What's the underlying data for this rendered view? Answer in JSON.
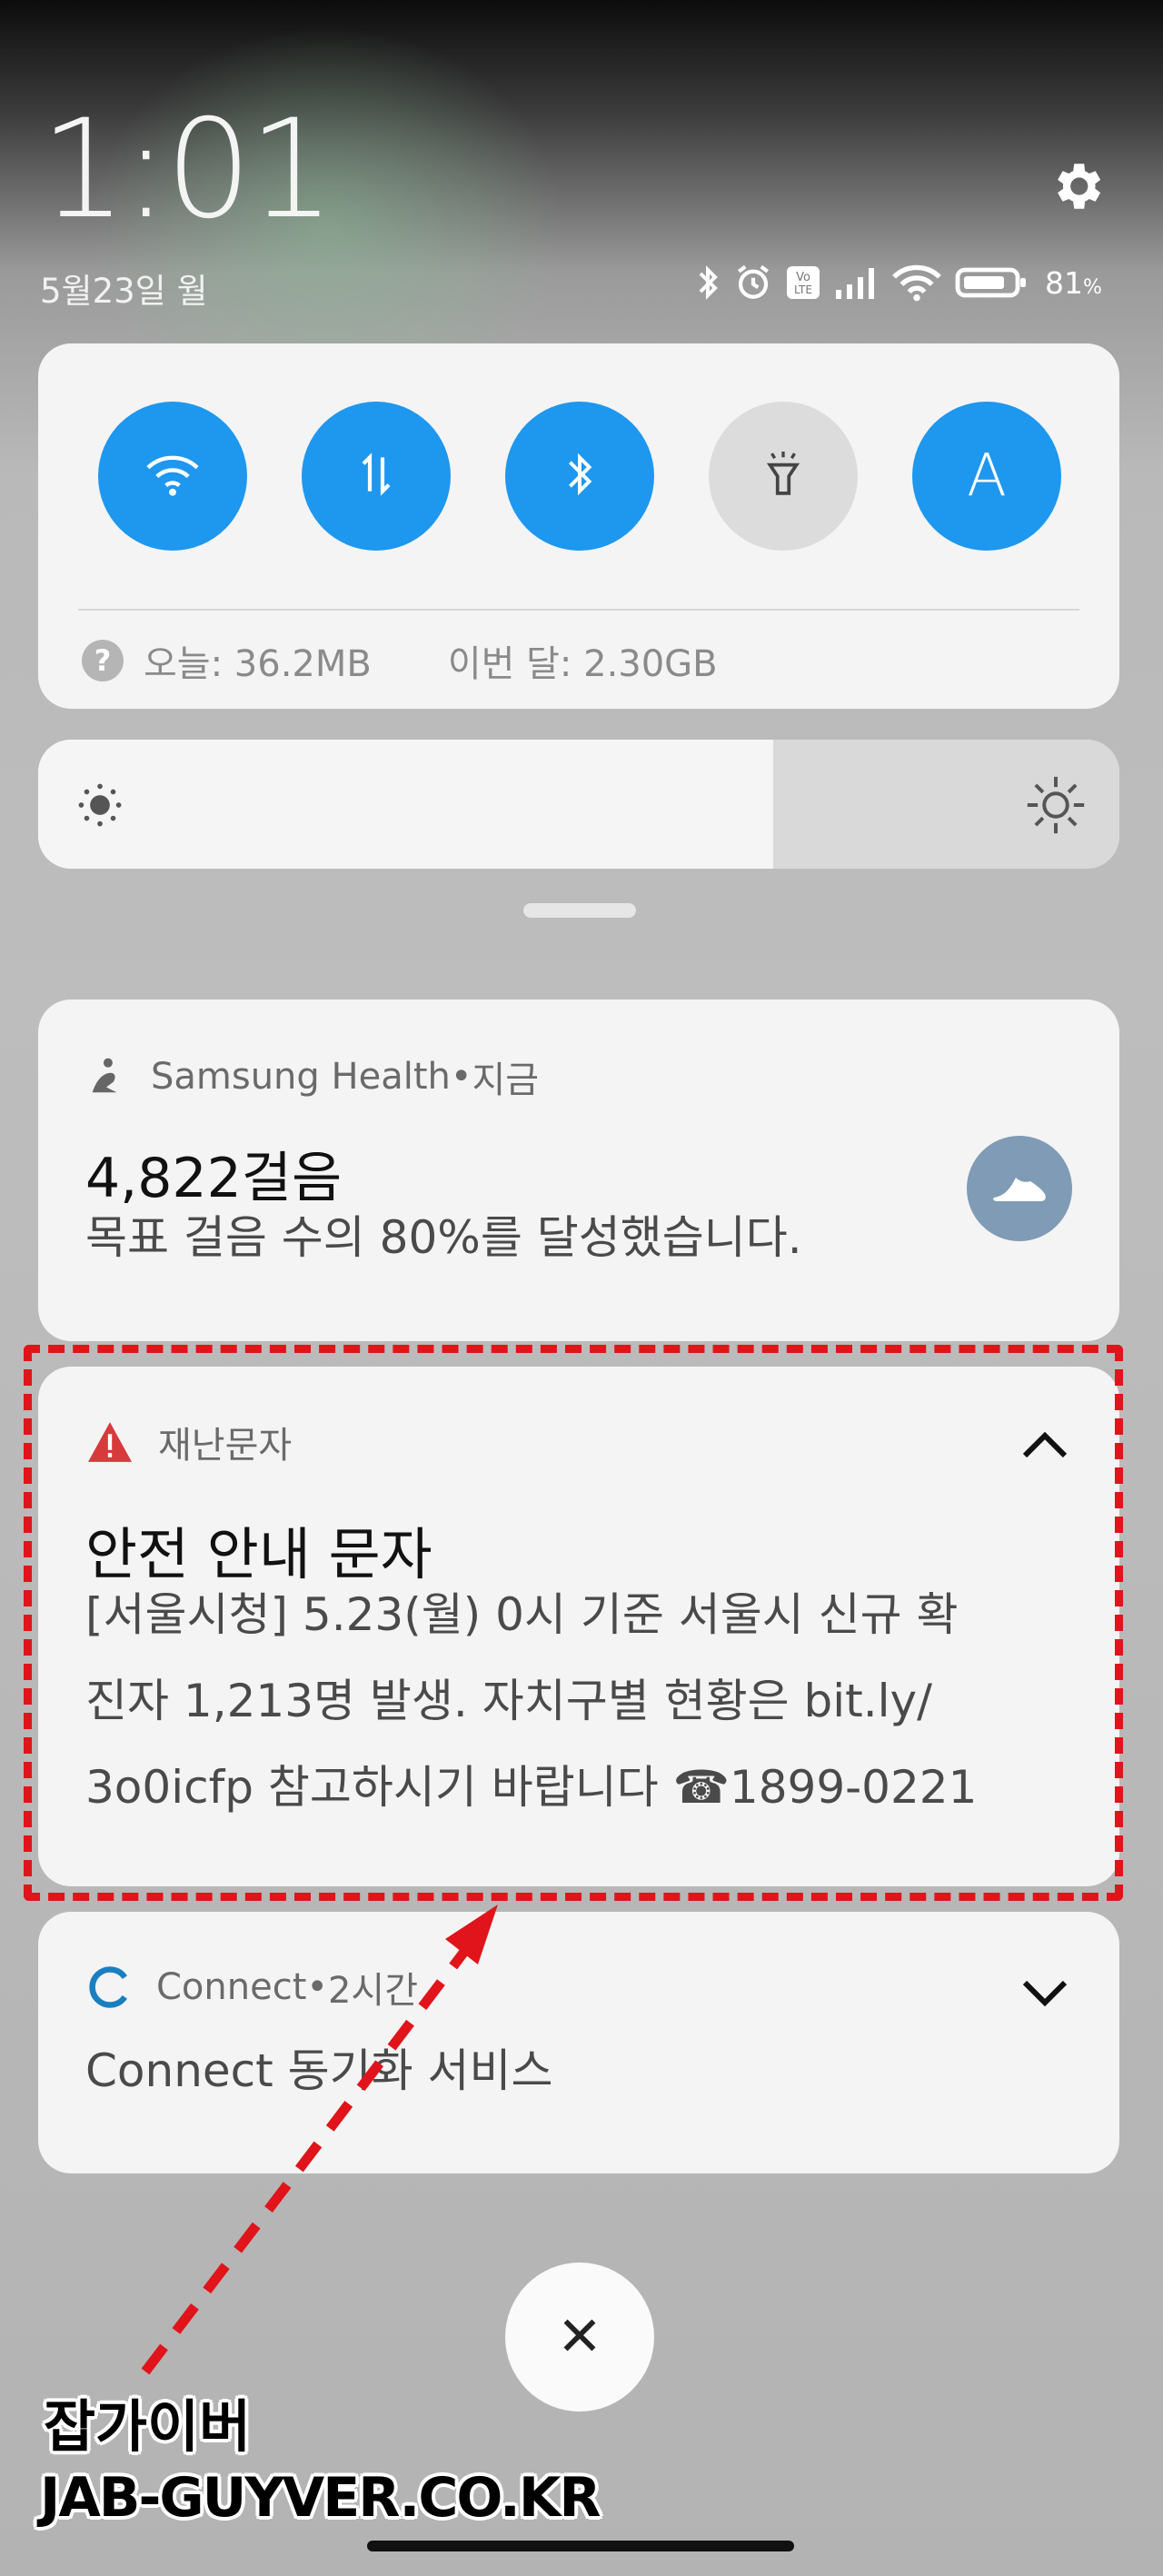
{
  "status": {
    "time": "1:01",
    "date": "5월23일 월",
    "battery_pct": "81",
    "battery_unit": "%"
  },
  "quick_settings": {
    "toggles": [
      {
        "name": "wifi",
        "icon": "wifi-icon",
        "on": true
      },
      {
        "name": "mobile-data",
        "icon": "data-arrows-icon",
        "on": true
      },
      {
        "name": "bluetooth",
        "icon": "bluetooth-icon",
        "on": true
      },
      {
        "name": "flashlight",
        "icon": "flashlight-icon",
        "on": false
      },
      {
        "name": "auto-brightness",
        "icon": "letter-a-icon",
        "label": "A",
        "on": true
      }
    ],
    "data_today": "오늘: 36.2MB",
    "data_month": "이번 달: 2.30GB"
  },
  "brightness": {
    "level": 0.68
  },
  "notifications": [
    {
      "app": "Samsung Health",
      "time": "지금",
      "title": "4,822걸음",
      "body": "목표 걸음 수의 80%를 달성했습니다."
    },
    {
      "app": "재난문자",
      "title": "안전 안내 문자",
      "body_lines": [
        "[서울시청] 5.23(월) 0시 기준 서울시 신규 확",
        "진자 1,213명 발생. 자치구별 현황은 bit.ly/",
        "3o0icfp 참고하시기 바랍니다 ☎1899-0221"
      ]
    },
    {
      "app": "Connect",
      "time": "2시간",
      "body": "Connect 동기화 서비스"
    }
  ],
  "separator": " • ",
  "clear_all_icon": "close-icon",
  "watermark": {
    "line1": "잡가이버",
    "line2": "JAB-GUYVER.CO.KR"
  },
  "colors": {
    "accent": "#1e97ef",
    "highlight": "#e0141a",
    "warning": "#d63a3a",
    "connect": "#1a7fc1"
  }
}
